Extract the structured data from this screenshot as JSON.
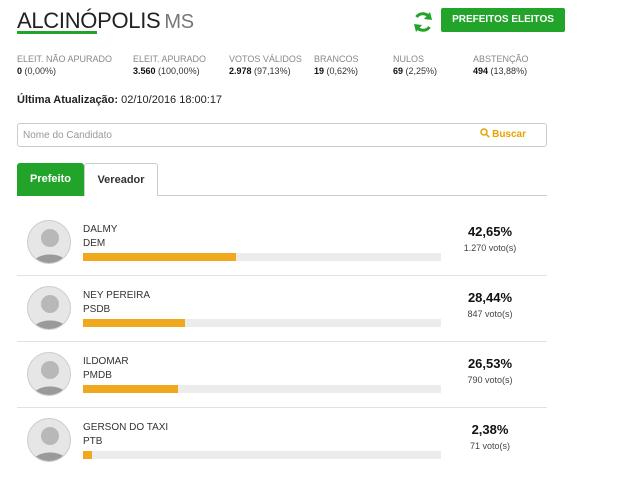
{
  "header": {
    "city": "ALCINÓPOLIS",
    "uf": "MS",
    "eleitos_button": "PREFEITOS ELEITOS",
    "refresh_icon": "refresh-icon"
  },
  "stats": [
    {
      "label": "ELEIT. NÃO APURADO",
      "value": "0",
      "pct": "(0,00%)"
    },
    {
      "label": "ELEIT. APURADO",
      "value": "3.560",
      "pct": "(100,00%)"
    },
    {
      "label": "VOTOS VÁLIDOS",
      "value": "2.978",
      "pct": "(97,13%)"
    },
    {
      "label": "BRANCOS",
      "value": "19",
      "pct": "(0,62%)"
    },
    {
      "label": "NULOS",
      "value": "69",
      "pct": "(2,25%)"
    },
    {
      "label": "ABSTENÇÃO",
      "value": "494",
      "pct": "(13,88%)"
    }
  ],
  "update": {
    "label": "Última Atualização:",
    "value": "02/10/2016 18:00:17"
  },
  "search": {
    "placeholder": "Nome do Candidato",
    "button": "Buscar"
  },
  "tabs": [
    {
      "label": "Prefeito",
      "active": true
    },
    {
      "label": "Vereador",
      "active": false
    }
  ],
  "candidates": [
    {
      "name": "DALMY",
      "party": "DEM",
      "pct_label": "42,65%",
      "pct_value": 42.65,
      "votes": "1.270 voto(s)"
    },
    {
      "name": "NEY PEREIRA",
      "party": "PSDB",
      "pct_label": "28,44%",
      "pct_value": 28.44,
      "votes": "847 voto(s)"
    },
    {
      "name": "ILDOMAR",
      "party": "PMDB",
      "pct_label": "26,53%",
      "pct_value": 26.53,
      "votes": "790 voto(s)"
    },
    {
      "name": "GERSON DO TAXI",
      "party": "PTB",
      "pct_label": "2,38%",
      "pct_value": 2.38,
      "votes": "71 voto(s)"
    }
  ],
  "colors": {
    "accent_green": "#22a32a",
    "bar_fill": "#f0a91e",
    "search_button": "#e8a300"
  }
}
